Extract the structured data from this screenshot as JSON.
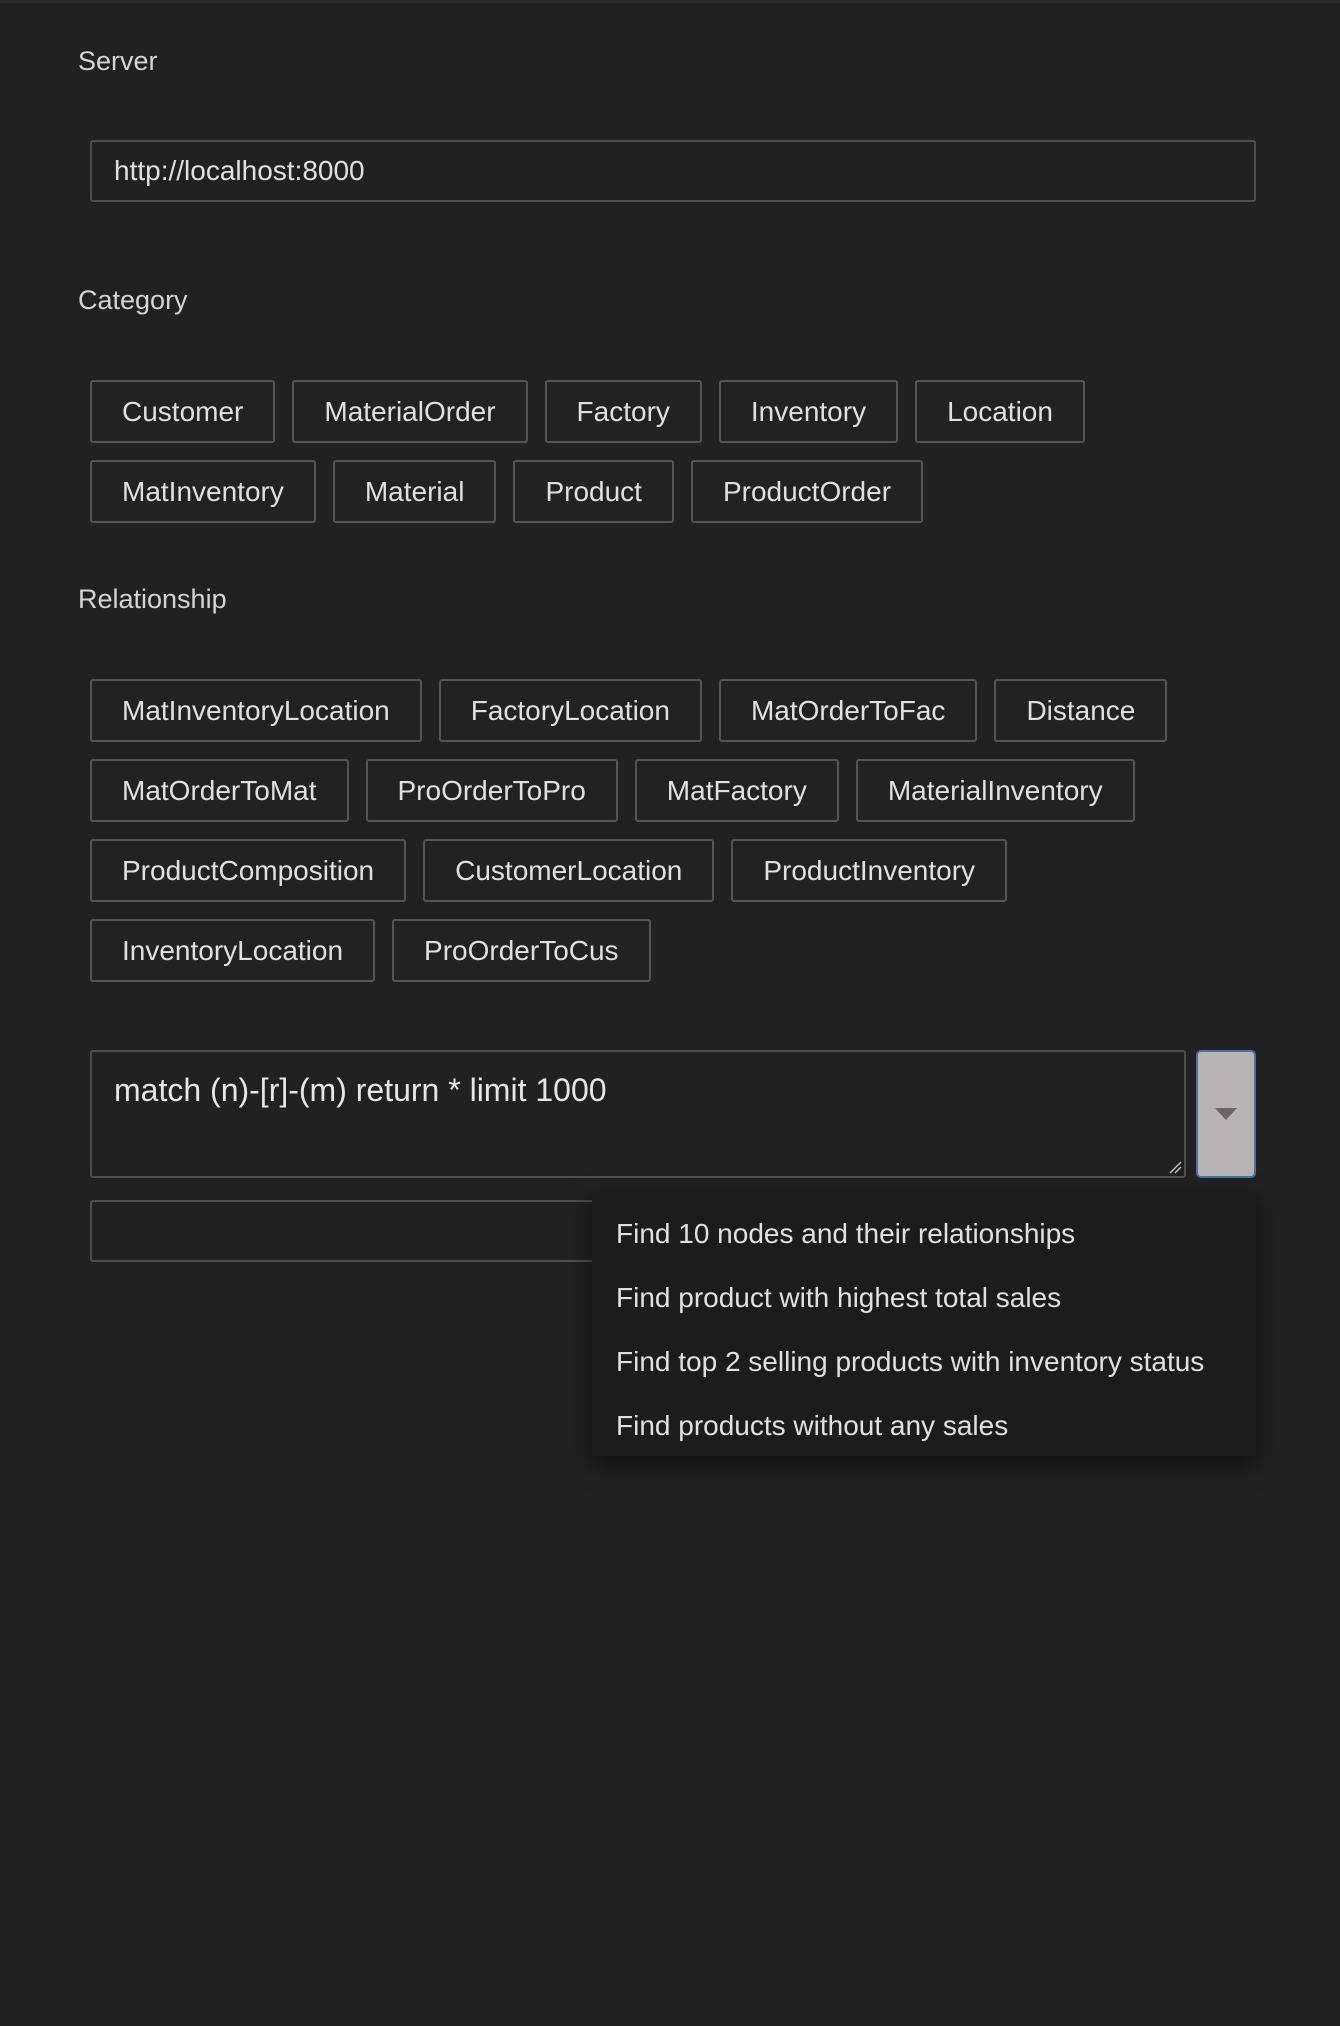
{
  "server": {
    "label": "Server",
    "value": "http://localhost:8000"
  },
  "category": {
    "label": "Category",
    "items": [
      "Customer",
      "MaterialOrder",
      "Factory",
      "Inventory",
      "Location",
      "MatInventory",
      "Material",
      "Product",
      "ProductOrder"
    ]
  },
  "relationship": {
    "label": "Relationship",
    "items": [
      "MatInventoryLocation",
      "FactoryLocation",
      "MatOrderToFac",
      "Distance",
      "MatOrderToMat",
      "ProOrderToPro",
      "MatFactory",
      "MaterialInventory",
      "ProductComposition",
      "CustomerLocation",
      "ProductInventory",
      "InventoryLocation",
      "ProOrderToCus"
    ]
  },
  "query": {
    "value": "match (n)-[r]-(m) return * limit 1000",
    "dropdown_icon": "caret-down-icon"
  },
  "query_suggestions": [
    "Find 10 nodes and their relationships",
    "Find product with highest total sales",
    "Find top 2 selling products with inventory status",
    "Find products without any sales"
  ],
  "colors": {
    "background": "#212121",
    "border": "#4e4e4e",
    "dropdown_button": "#b8b3b5",
    "dropdown_focus": "#4a6fa5",
    "menu_background": "#1c1c1c"
  }
}
